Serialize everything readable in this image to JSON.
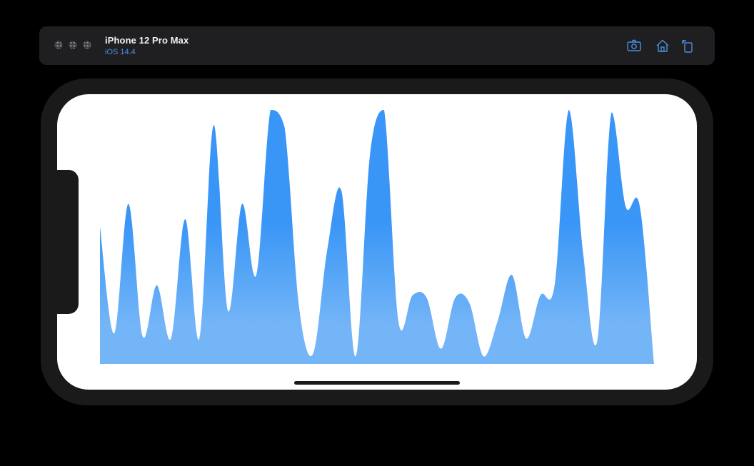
{
  "simulator": {
    "device_name": "iPhone 12 Pro Max",
    "os_version": "iOS 14.4",
    "window_controls": [
      {
        "name": "close",
        "icon": "hatched-circle-icon"
      },
      {
        "name": "minimize",
        "icon": "hatched-circle-icon"
      },
      {
        "name": "zoom",
        "icon": "hatched-circle-icon"
      }
    ],
    "toolbar_buttons": [
      {
        "name": "screenshot",
        "icon": "camera-icon"
      },
      {
        "name": "home",
        "icon": "home-icon"
      },
      {
        "name": "rotate",
        "icon": "rotate-icon"
      }
    ],
    "accent_color": "#4a90e2"
  },
  "chart_data": {
    "type": "area",
    "title": "",
    "xlabel": "",
    "ylabel": "",
    "ylim": [
      0,
      100
    ],
    "grid": false,
    "colors": {
      "top": "#3a96f6",
      "bottom": "#74b5f7"
    },
    "series": [
      {
        "values": [
          54,
          12,
          63,
          11,
          31,
          10,
          57,
          10,
          94,
          21,
          63,
          35,
          100,
          93,
          23,
          4,
          45,
          68,
          3,
          82,
          100,
          17,
          27,
          26,
          6,
          26,
          24,
          3,
          17,
          35,
          10,
          27,
          31,
          100,
          44,
          9,
          99,
          62,
          62,
          0
        ]
      }
    ]
  }
}
